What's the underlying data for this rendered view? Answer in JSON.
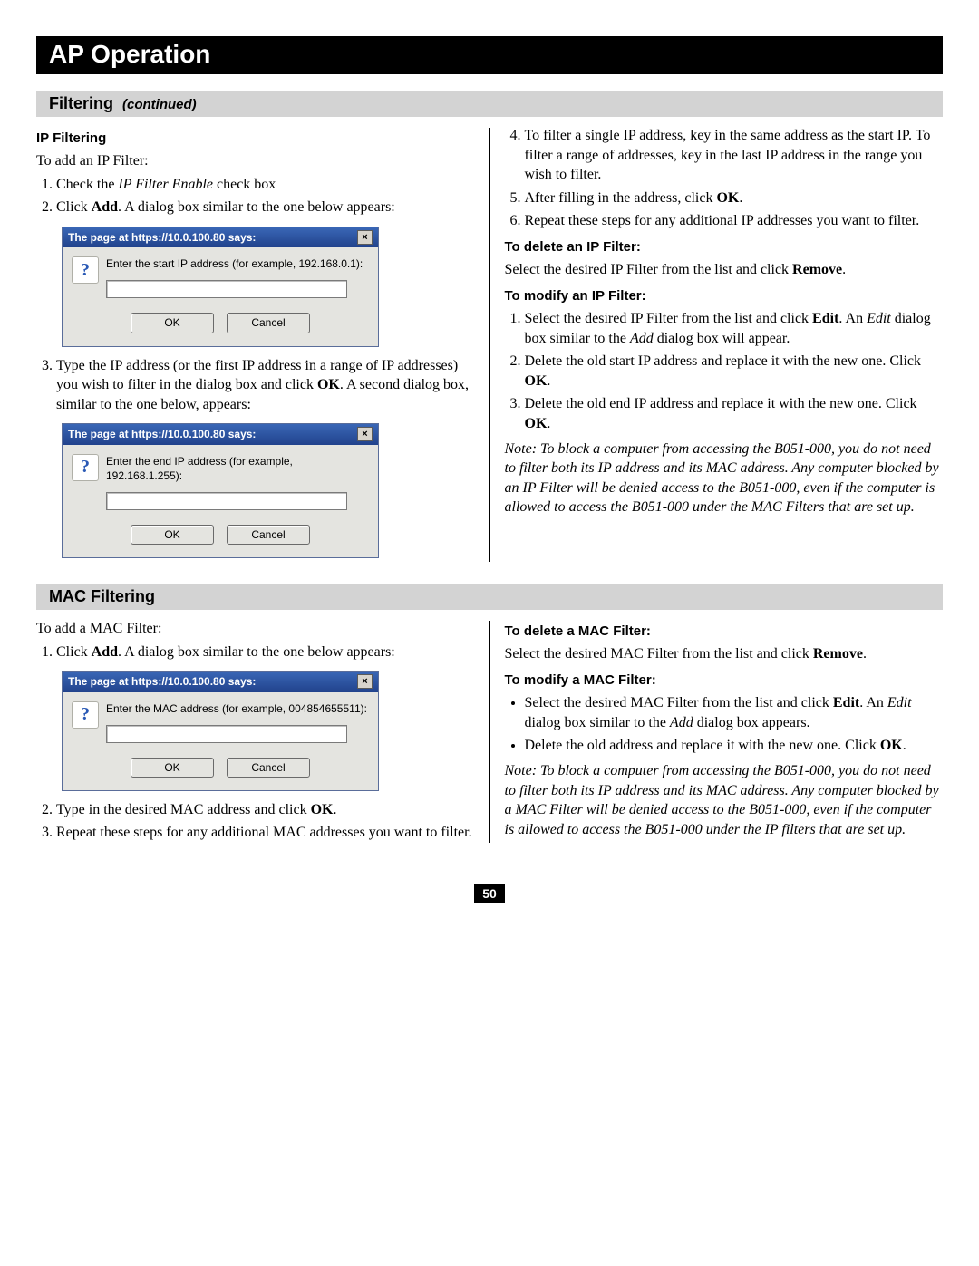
{
  "header": {
    "title": "AP Operation"
  },
  "filtering_header": {
    "label": "Filtering",
    "continued": "(continued)"
  },
  "ip": {
    "heading": "IP Filtering",
    "intro": "To add an IP Filter:",
    "step1_pre": "Check the ",
    "step1_em": "IP Filter Enable",
    "step1_post": " check box",
    "step2_pre": "Click ",
    "step2_bold": "Add",
    "step2_post": ". A dialog box similar to the one below appears:",
    "dialog1": {
      "title": "The page at https://10.0.100.80 says:",
      "prompt": "Enter the start IP address (for example, 192.168.0.1):",
      "ok": "OK",
      "cancel": "Cancel"
    },
    "step3_pre": "Type the IP address (or the first IP address in a range of IP addresses) you wish to filter in the dialog box and click ",
    "step3_bold": "OK",
    "step3_post": ". A second dialog box, similar to the one below, appears:",
    "dialog2": {
      "title": "The page at https://10.0.100.80 says:",
      "prompt": "Enter the end IP address (for example, 192.168.1.255):",
      "ok": "OK",
      "cancel": "Cancel"
    },
    "step4": "To filter a single IP address, key in the same address as the start IP. To filter a range of addresses, key in the last IP address in the range you wish to filter.",
    "step5_pre": "After filling in the address, click ",
    "step5_bold": "OK",
    "step5_post": ".",
    "step6": "Repeat these steps for any additional IP addresses you want to filter.",
    "delete_heading": "To delete an IP Filter:",
    "delete_text_pre": "Select the desired IP Filter from the list and click ",
    "delete_text_bold": "Remove",
    "delete_text_post": ".",
    "modify_heading": "To modify an IP Filter:",
    "mod1_pre": "Select the desired IP Filter from the list and click ",
    "mod1_bold": "Edit",
    "mod1_mid": ". An ",
    "mod1_em": "Edit",
    "mod1_mid2": " dialog box similar to the ",
    "mod1_em2": "Add",
    "mod1_post": " dialog box will appear.",
    "mod2_pre": "Delete the old start IP address and replace it with the new one. Click ",
    "mod2_bold": "OK",
    "mod2_post": ".",
    "mod3_pre": "Delete the old end IP address and replace it with the new one. Click ",
    "mod3_bold": "OK",
    "mod3_post": ".",
    "note": "Note: To block a computer from accessing the B051-000, you do not need to filter both its IP address and its MAC address. Any computer blocked by an IP Filter will be denied access to the B051-000, even if the computer is allowed to access the B051-000 under the MAC Filters that are set up."
  },
  "mac_header": {
    "label": "MAC Filtering"
  },
  "mac": {
    "intro": "To add a MAC Filter:",
    "step1_pre": "Click ",
    "step1_bold": "Add",
    "step1_post": ". A dialog box similar to the one below appears:",
    "dialog": {
      "title": "The page at https://10.0.100.80 says:",
      "prompt": "Enter the MAC address (for example, 004854655511):",
      "ok": "OK",
      "cancel": "Cancel"
    },
    "step2_pre": "Type in the desired MAC address and click ",
    "step2_bold": "OK",
    "step2_post": ".",
    "step3": "Repeat these steps for any additional MAC addresses you want to filter.",
    "delete_heading": "To delete a MAC Filter:",
    "delete_text_pre": "Select the desired MAC Filter from the list and click ",
    "delete_text_bold": "Remove",
    "delete_text_post": ".",
    "modify_heading": "To modify a MAC Filter:",
    "mod1_pre": "Select the desired MAC Filter from the list and click ",
    "mod1_bold": "Edit",
    "mod1_mid": ". An ",
    "mod1_em": "Edit",
    "mod1_mid2": " dialog box similar to the ",
    "mod1_em2": "Add",
    "mod1_post": " dialog box appears.",
    "mod2_pre": "Delete the old address and replace it with the new one. Click ",
    "mod2_bold": "OK",
    "mod2_post": ".",
    "note": "Note: To block a computer from accessing the B051-000, you do not need to filter both its IP address and its MAC address. Any computer blocked by a MAC Filter will be denied access to the B051-000, even if the computer is allowed to access the B051-000 under the IP filters that are set up."
  },
  "page_number": "50"
}
